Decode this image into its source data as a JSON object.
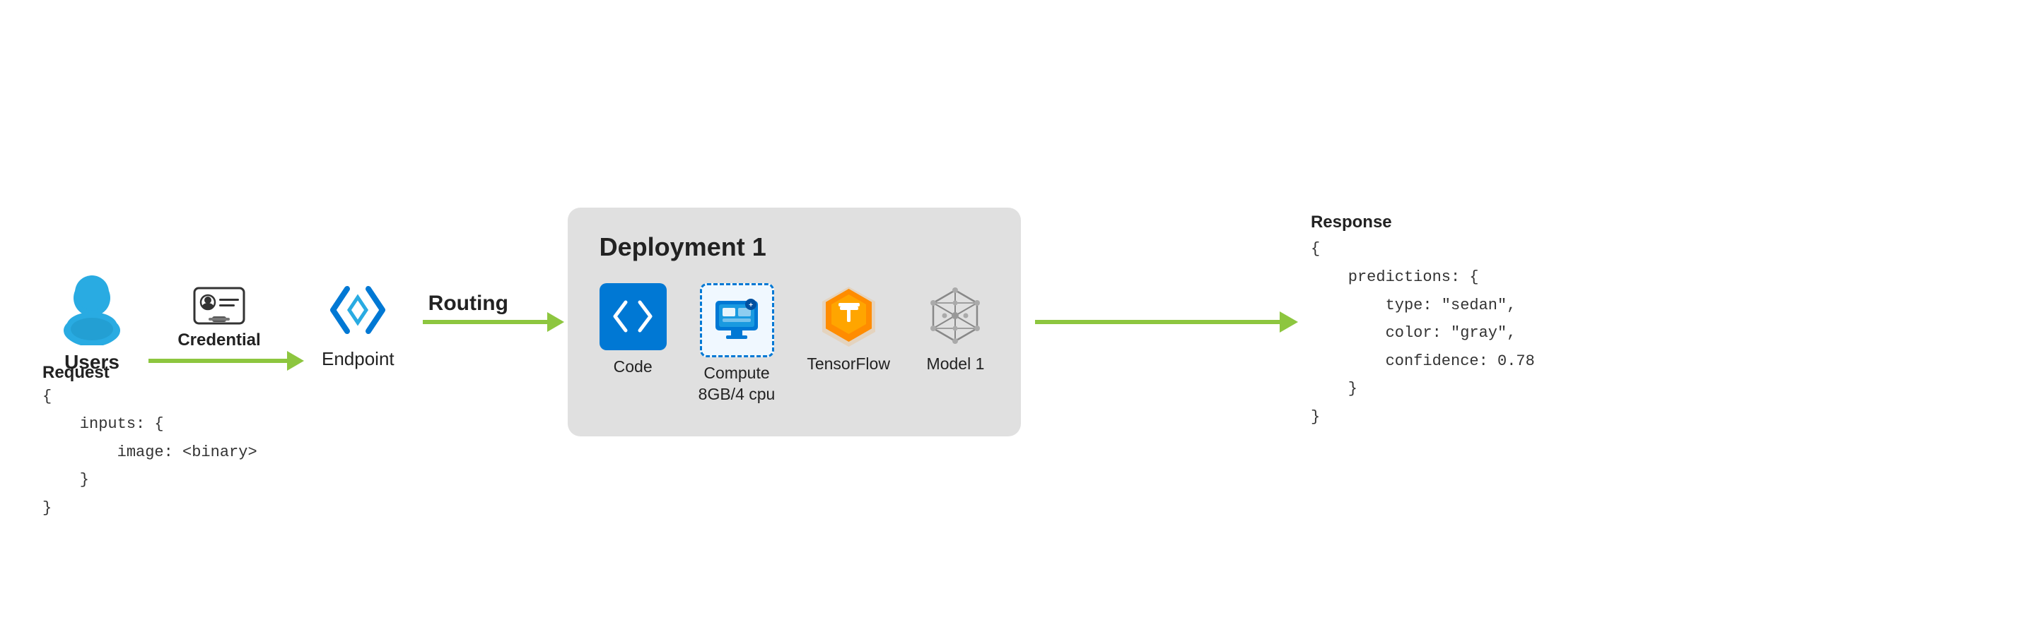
{
  "diagram": {
    "user": {
      "label": "Users"
    },
    "credential": {
      "label": "Credential"
    },
    "request": {
      "label": "Request",
      "code": "{\n    inputs: {\n        image: <binary>\n    }\n}"
    },
    "endpoint": {
      "label": "Endpoint"
    },
    "routing": {
      "label": "Routing"
    },
    "deployment": {
      "title": "Deployment 1",
      "items": [
        {
          "label": "Code",
          "type": "code"
        },
        {
          "label": "Compute\n8GB/4 cpu",
          "type": "compute"
        },
        {
          "label": "TensorFlow",
          "type": "tensorflow"
        },
        {
          "label": "Model 1",
          "type": "model"
        }
      ]
    },
    "response": {
      "label": "Response",
      "code": "{\n    predictions: {\n        type: \"sedan\",\n        color: \"gray\",\n        confidence: 0.78\n    }\n}"
    }
  }
}
